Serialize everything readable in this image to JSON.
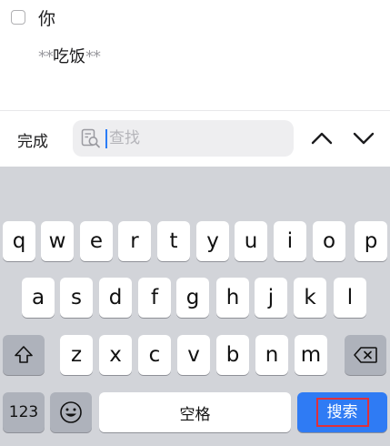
{
  "note": {
    "checklist_item": "你",
    "body_prefix": "**",
    "body_text": "吃饭",
    "body_suffix": "**"
  },
  "find_bar": {
    "done_label": "完成",
    "search_placeholder": "查找",
    "search_value": "",
    "prev_icon": "chevron-up-icon",
    "next_icon": "chevron-down-icon"
  },
  "keyboard": {
    "row1": [
      "q",
      "w",
      "e",
      "r",
      "t",
      "y",
      "u",
      "i",
      "o",
      "p"
    ],
    "row2": [
      "a",
      "s",
      "d",
      "f",
      "g",
      "h",
      "j",
      "k",
      "l"
    ],
    "row3": [
      "z",
      "x",
      "c",
      "v",
      "b",
      "n",
      "m"
    ],
    "shift_icon": "shift-icon",
    "delete_icon": "delete-icon",
    "numbers_label": "123",
    "emoji_icon": "emoji-icon",
    "space_label": "空格",
    "search_label": "搜索",
    "accent_color": "#2f7bf4"
  }
}
